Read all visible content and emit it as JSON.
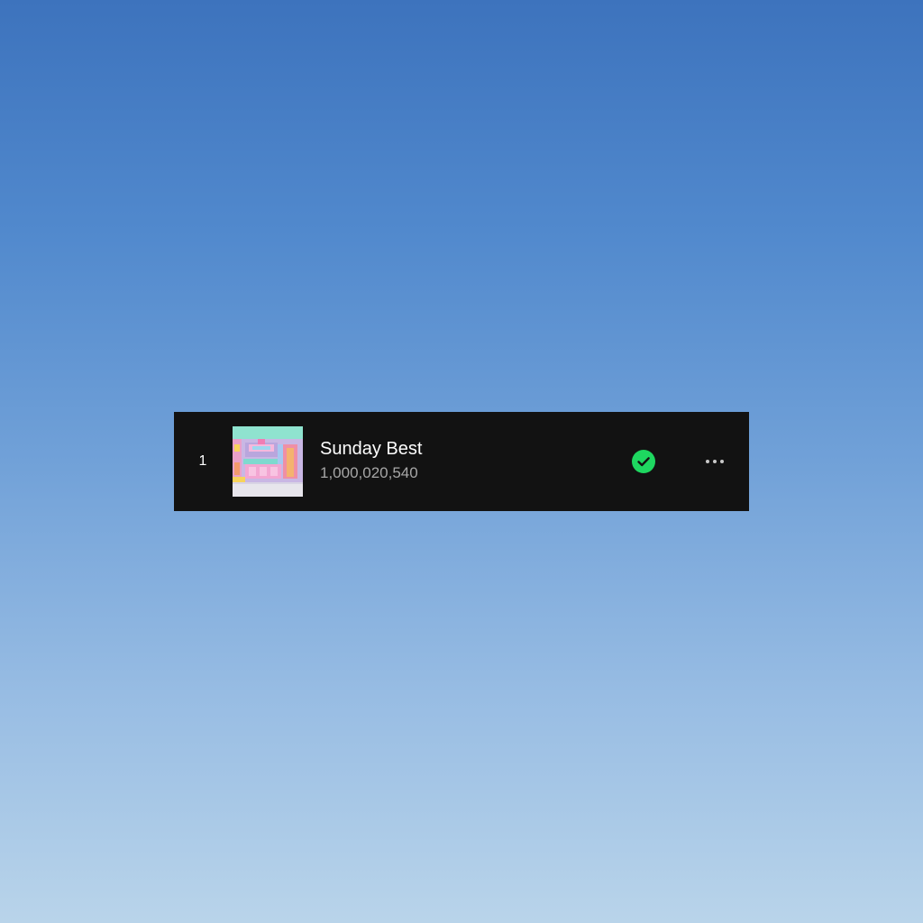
{
  "track": {
    "number": "1",
    "title": "Sunday Best",
    "plays": "1,000,020,540",
    "cover_icon": "album-cover-art",
    "saved": true,
    "saved_icon": "check-circle-icon",
    "more_icon": "more-options-icon"
  },
  "colors": {
    "row_background": "#121212",
    "accent_green": "#1ed760",
    "primary_text": "#ffffff",
    "secondary_text": "#a7a7a7"
  }
}
